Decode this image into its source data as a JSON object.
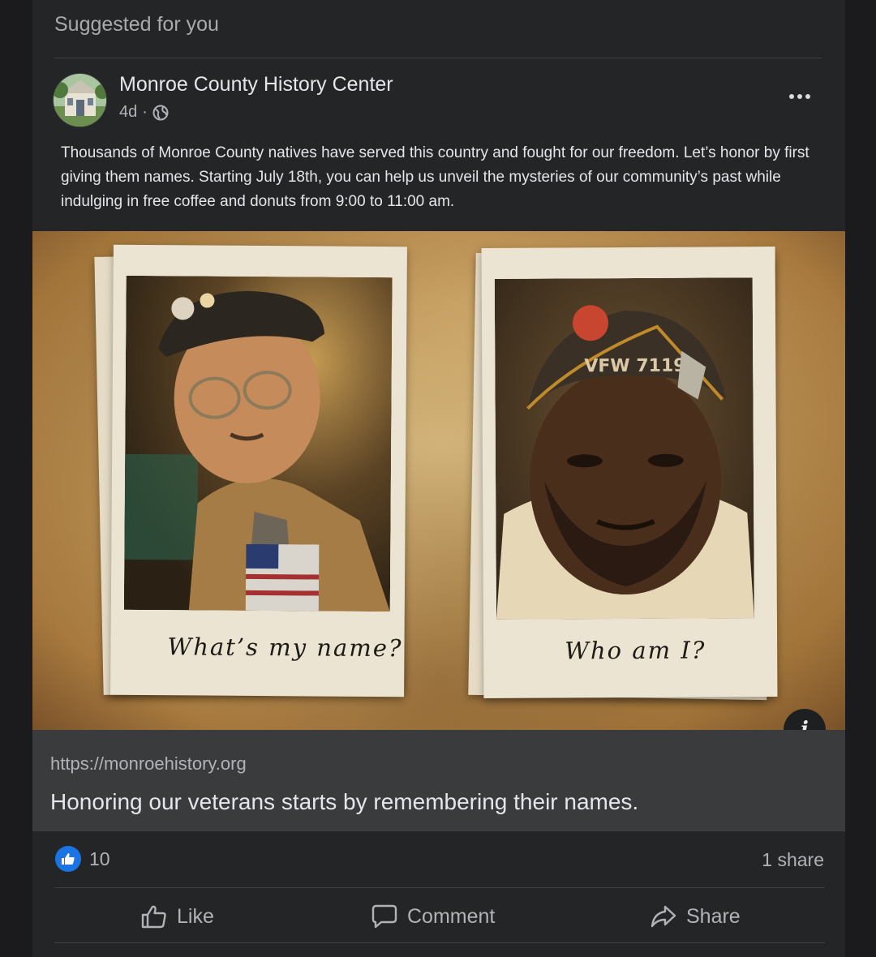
{
  "feed": {
    "section_title": "Suggested for you"
  },
  "post": {
    "page_name": "Monroe County History Center",
    "time": "4d",
    "separator": "·",
    "audience_icon": "globe-icon",
    "text": "Thousands of Monroe County natives have served this country and fought for our freedom. Let’s honor by first giving them names. Starting July 18th, you can help us unveil the mysteries of our community’s past while indulging in free coffee and donuts from 9:00 to 11:00 am.",
    "image": {
      "left_caption": "What’s my name?",
      "right_caption": "Who am I?",
      "right_cap_text": "VFW 7119"
    },
    "link": {
      "url": "https://monroehistory.org",
      "title": "Honoring our veterans starts by remembering their names."
    },
    "stats": {
      "reaction_count": "10",
      "shares": "1 share"
    },
    "actions": {
      "like": "Like",
      "comment": "Comment",
      "share": "Share"
    }
  },
  "colors": {
    "background": "#242526",
    "like_blue": "#1b74e4",
    "text_primary": "#e4e6eb",
    "text_secondary": "#b0b3b8"
  }
}
